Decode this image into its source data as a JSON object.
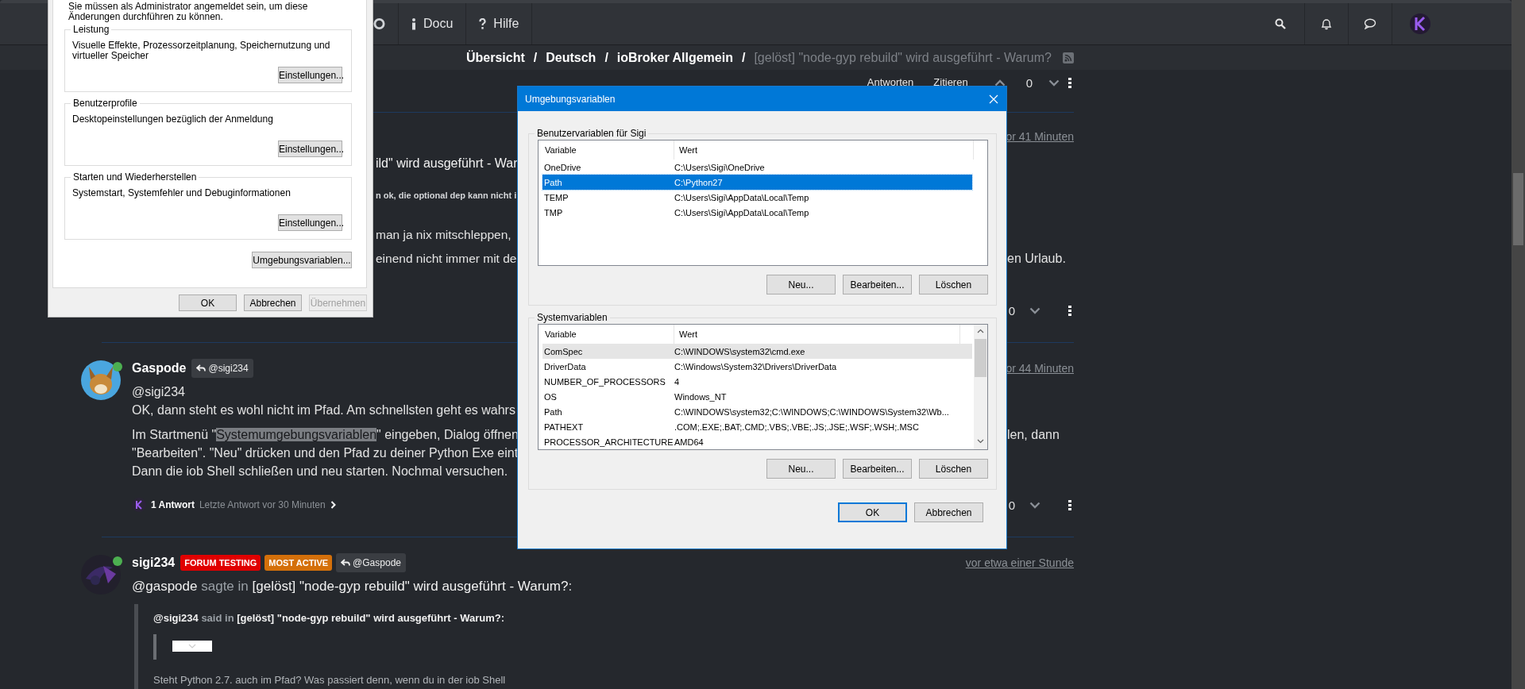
{
  "nav": {
    "items": [
      {
        "label": "Docu"
      },
      {
        "label": "Hilfe"
      }
    ]
  },
  "breadcrumb": {
    "items": [
      {
        "label": "Übersicht",
        "separator": "/"
      },
      {
        "label": "Deutsch",
        "separator": "/"
      },
      {
        "label": "ioBroker Allgemein",
        "separator": "/"
      }
    ],
    "current": "[gelöst] \"node-gyp rebuild\" wird ausgeführt - Warum?"
  },
  "topic_actions": {
    "reply": "Antworten",
    "quote": "Zitieren",
    "votes": "0"
  },
  "posts": [
    {
      "kind": "covered",
      "time": "or 41 Minuten",
      "fragments": [
        {
          "kind": "title",
          "left": "ild\" wird ausgeführt - War"
        },
        {
          "kind": "small",
          "left": "n ok, die optional dep kann nicht i"
        },
        {
          "kind": "text",
          "left": "man ja nix mitschleppen,"
        },
        {
          "kind": "text",
          "left": "einend nicht immer mit de",
          "right": "en Urlaub."
        }
      ],
      "votes": "0"
    },
    {
      "kind": "answer",
      "author": "Gaspode",
      "online": true,
      "reply_to": "@sigi234",
      "time": "or 44 Minuten",
      "paragraphs": [
        [
          {
            "text": "@sigi234"
          },
          {
            "text": "OK, dann steht es wohl nicht im Pfad. Am schnellsten geht es wahrs"
          }
        ],
        [
          {
            "before": "Im Startmenü \"",
            "highlight": "Systemumgebungsvariablen",
            "after": "\" eingeben, Dialog öffnen",
            "right": "len, dann"
          },
          {
            "text": "\"Bearbeiten\". \"Neu\" drücken und den Pfad zu deiner Python Exe eint"
          },
          {
            "text": "Dann die iob Shell schließen und neu starten. Nochmal versuchen."
          }
        ]
      ],
      "replies": {
        "count": "1 Antwort",
        "last": "Letzte Antwort vor 30 Minuten"
      },
      "votes": "0"
    },
    {
      "kind": "quote",
      "author": "sigi234",
      "online": true,
      "badges": [
        {
          "label": "FORUM TESTING",
          "color": "#e00000"
        },
        {
          "label": "MOST ACTIVE",
          "color": "#d4700a"
        }
      ],
      "reply_to": "@Gaspode",
      "time": "vor etwa einer Stunde",
      "intro": {
        "mention": "@gaspode",
        "verb": "sagte in",
        "link": "[gelöst] \"node-gyp rebuild\" wird ausgeführt - Warum?",
        "suffix": ":"
      },
      "quote": {
        "mention": "@sigi234",
        "verb": "said in",
        "link": "[gelöst] \"node-gyp rebuild\" wird ausgeführt - Warum?",
        "suffix": ":",
        "text": "Steht Python 2.7. auch im Pfad? Was passiert denn, wenn du in der iob Shell"
      }
    }
  ],
  "system_dialog": {
    "intro": "Sie müssen als Administrator angemeldet sein, um diese Änderungen durchführen zu können.",
    "groups": [
      {
        "title": "Leistung",
        "text": "Visuelle Effekte, Prozessorzeitplanung, Speichernutzung und virtueller Speicher",
        "button": "Einstellungen..."
      },
      {
        "title": "Benutzerprofile",
        "text": "Desktopeinstellungen bezüglich der Anmeldung",
        "button": "Einstellungen..."
      },
      {
        "title": "Starten und Wiederherstellen",
        "text": "Systemstart, Systemfehler und Debuginformationen",
        "button": "Einstellungen..."
      }
    ],
    "env_button": "Umgebungsvariablen...",
    "buttons": [
      {
        "label": "OK",
        "disabled": false
      },
      {
        "label": "Abbrechen",
        "disabled": false
      },
      {
        "label": "Übernehmen",
        "disabled": true
      }
    ]
  },
  "env_dialog": {
    "title": "Umgebungsvariablen",
    "groups": [
      {
        "title": "Benutzervariablen für Sigi",
        "focused": true,
        "scrollbar": false,
        "columns": [
          "Variable",
          "Wert"
        ],
        "rows": [
          {
            "variable": "OneDrive",
            "value": "C:\\Users\\Sigi\\OneDrive",
            "selected": false
          },
          {
            "variable": "Path",
            "value": "C:\\Python27",
            "selected": true
          },
          {
            "variable": "TEMP",
            "value": "C:\\Users\\Sigi\\AppData\\Local\\Temp",
            "selected": false
          },
          {
            "variable": "TMP",
            "value": "C:\\Users\\Sigi\\AppData\\Local\\Temp",
            "selected": false
          }
        ],
        "buttons": [
          "Neu...",
          "Bearbeiten...",
          "Löschen"
        ]
      },
      {
        "title": "Systemvariablen",
        "focused": false,
        "scrollbar": true,
        "columns": [
          "Variable",
          "Wert"
        ],
        "rows": [
          {
            "variable": "ComSpec",
            "value": "C:\\WINDOWS\\system32\\cmd.exe",
            "selected": true
          },
          {
            "variable": "DriverData",
            "value": "C:\\Windows\\System32\\Drivers\\DriverData",
            "selected": false
          },
          {
            "variable": "NUMBER_OF_PROCESSORS",
            "value": "4",
            "selected": false
          },
          {
            "variable": "OS",
            "value": "Windows_NT",
            "selected": false
          },
          {
            "variable": "Path",
            "value": "C:\\WINDOWS\\system32;C:\\WINDOWS;C:\\WINDOWS\\System32\\Wb...",
            "selected": false
          },
          {
            "variable": "PATHEXT",
            "value": ".COM;.EXE;.BAT;.CMD;.VBS;.VBE;.JS;.JSE;.WSF;.WSH;.MSC",
            "selected": false
          },
          {
            "variable": "PROCESSOR_ARCHITECTURE",
            "value": "AMD64",
            "selected": false
          }
        ],
        "buttons": [
          "Neu...",
          "Bearbeiten...",
          "Löschen"
        ]
      }
    ],
    "buttons": [
      {
        "label": "OK",
        "default": true
      },
      {
        "label": "Abbrechen",
        "default": false
      }
    ]
  }
}
